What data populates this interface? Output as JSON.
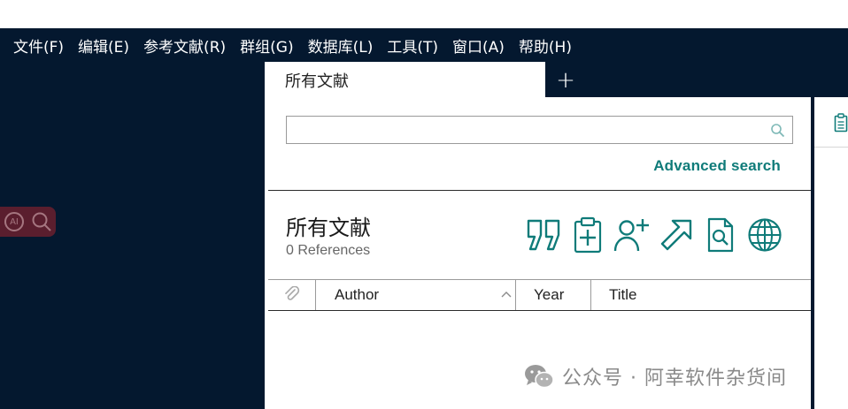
{
  "menu": [
    "文件(F)",
    "编辑(E)",
    "参考文献(R)",
    "群组(G)",
    "数据库(L)",
    "工具(T)",
    "窗口(A)",
    "帮助(H)"
  ],
  "ai_search": {
    "badge": "AI"
  },
  "tabs": {
    "active_label": "所有文献",
    "add_label": "+"
  },
  "search": {
    "value": "",
    "placeholder": "",
    "advanced_link": "Advanced search"
  },
  "library": {
    "title": "所有文献",
    "count": "0 References"
  },
  "toolbar": [
    "quote-icon",
    "clipboard-add-icon",
    "add-user-icon",
    "share-arrow-icon",
    "document-search-icon",
    "globe-icon"
  ],
  "table": {
    "columns": {
      "author": "Author",
      "year": "Year",
      "title": "Title"
    },
    "rows": []
  },
  "watermark": {
    "text": "公众号 · 阿幸软件杂货间"
  },
  "colors": {
    "dark_bg": "#04182f",
    "accent": "#0f7b79",
    "ai_bg": "#5a1e2e"
  }
}
